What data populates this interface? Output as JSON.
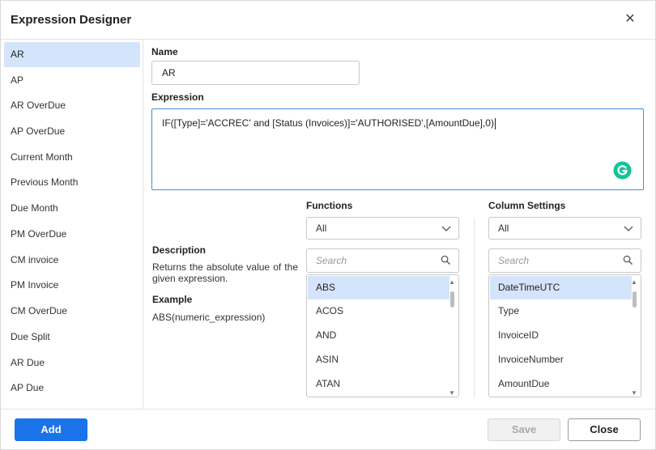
{
  "dialog": {
    "title": "Expression Designer",
    "close_icon": "close-icon"
  },
  "sidebar": {
    "items": [
      {
        "label": "AR",
        "selected": true
      },
      {
        "label": "AP"
      },
      {
        "label": "AR OverDue"
      },
      {
        "label": "AP OverDue"
      },
      {
        "label": "Current Month"
      },
      {
        "label": "Previous Month"
      },
      {
        "label": "Due Month"
      },
      {
        "label": "PM OverDue"
      },
      {
        "label": "CM invoice"
      },
      {
        "label": "PM Invoice"
      },
      {
        "label": "CM OverDue"
      },
      {
        "label": "Due Split"
      },
      {
        "label": "AR Due"
      },
      {
        "label": "AP Due"
      }
    ]
  },
  "form": {
    "name_label": "Name",
    "name_value": "AR",
    "expression_label": "Expression",
    "expression_value": "IF([Type]='ACCREC' and [Status (Invoices)]='AUTHORISED',[AmountDue],0)"
  },
  "help": {
    "description_title": "Description",
    "description_text": "Returns the absolute value of the given expression.",
    "example_title": "Example",
    "example_text": "ABS(numeric_expression)"
  },
  "functions": {
    "label": "Functions",
    "dropdown_value": "All",
    "search_placeholder": "Search",
    "items": [
      {
        "label": "ABS",
        "selected": true
      },
      {
        "label": "ACOS"
      },
      {
        "label": "AND"
      },
      {
        "label": "ASIN"
      },
      {
        "label": "ATAN"
      }
    ]
  },
  "columns": {
    "label": "Column Settings",
    "dropdown_value": "All",
    "search_placeholder": "Search",
    "items": [
      {
        "label": "DateTimeUTC",
        "selected": true
      },
      {
        "label": "Type"
      },
      {
        "label": "InvoiceID"
      },
      {
        "label": "InvoiceNumber"
      },
      {
        "label": "AmountDue"
      }
    ]
  },
  "footer": {
    "add_label": "Add",
    "save_label": "Save",
    "close_label": "Close"
  },
  "colors": {
    "accent": "#1a73e8",
    "selection": "#d4e5fb",
    "grammarly": "#15c39a"
  }
}
